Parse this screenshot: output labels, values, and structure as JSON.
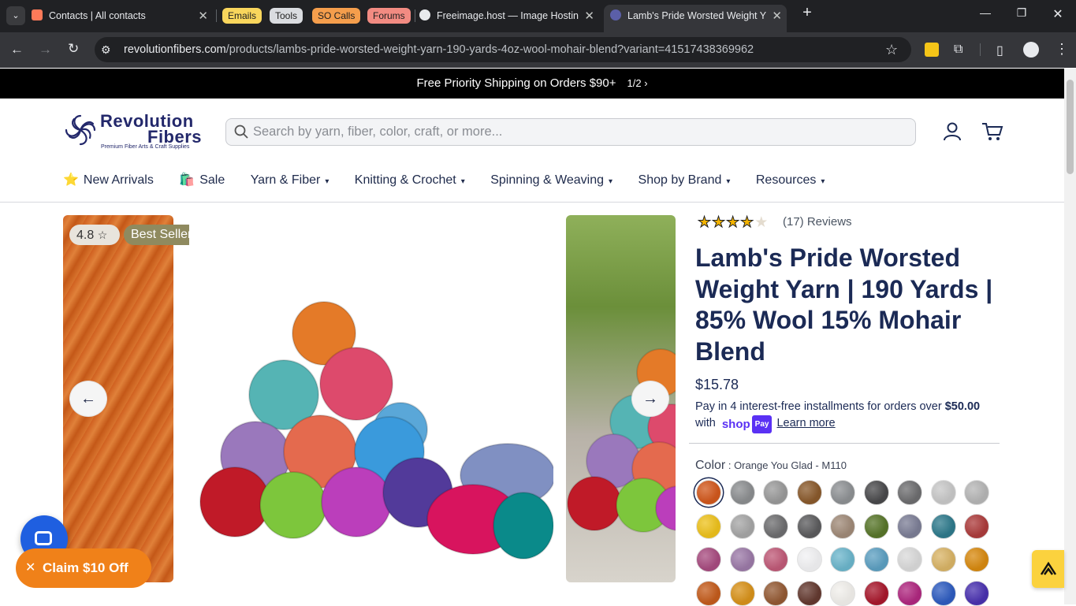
{
  "browser": {
    "tabs": [
      {
        "title": "Contacts | All contacts",
        "active": false
      },
      {
        "title": "Freeimage.host — Image Hostin",
        "active": false
      },
      {
        "title": "Lamb's Pride Worsted Weight Y",
        "active": true
      }
    ],
    "bookmark_chips": [
      {
        "label": "Emails",
        "color": "#f9d65c"
      },
      {
        "label": "Tools",
        "color": "#dadce0"
      },
      {
        "label": "SO Calls",
        "color": "#f59e4c"
      },
      {
        "label": "Forums",
        "color": "#f28b82"
      }
    ],
    "url_domain": "revolutionfibers.com",
    "url_path": "/products/lambs-pride-worsted-weight-yarn-190-yards-4oz-wool-mohair-blend?variant=41517438369962"
  },
  "promo": {
    "text": "Free Priority Shipping on Orders $90+",
    "page": "1/2"
  },
  "logo": {
    "line1": "Revolution",
    "line2": "Fibers",
    "tagline": "Premium Fiber Arts & Craft Supplies"
  },
  "search": {
    "placeholder": "Search by yarn, fiber, color, craft, or more..."
  },
  "nav": [
    {
      "label": "New Arrivals",
      "emoji": "⭐",
      "dropdown": false
    },
    {
      "label": "Sale",
      "emoji": "🛍️",
      "dropdown": false
    },
    {
      "label": "Yarn & Fiber",
      "dropdown": true
    },
    {
      "label": "Knitting & Crochet",
      "dropdown": true
    },
    {
      "label": "Spinning & Weaving",
      "dropdown": true
    },
    {
      "label": "Shop by Brand",
      "dropdown": true
    },
    {
      "label": "Resources",
      "dropdown": true
    }
  ],
  "gallery": {
    "rating": "4.8",
    "badge": "Best Seller"
  },
  "product": {
    "reviews": "(17) Reviews",
    "stars_filled": 4,
    "title": "Lamb's Pride Worsted Weight Yarn | 190 Yards | 85% Wool 15% Mohair Blend",
    "price": "$15.78",
    "installments_prefix": "Pay in 4 interest-free installments for orders over ",
    "installments_amount": "$50.00",
    "with": "with",
    "shop": "shop",
    "pay": "Pay",
    "learn_more": "Learn more",
    "color_label": "Color",
    "color_value": " : Orange You Glad - M110",
    "swatches": [
      [
        "#d2581c",
        "#8c8e90",
        "#9a9a9a",
        "#8a5a2c",
        "#8e9194",
        "#4a4a4c",
        "#6e6e70",
        "#c8c8c8",
        "#b6b6b6"
      ],
      [
        "#eec21c",
        "#a6a6a6",
        "#6e6e70",
        "#5c5c5e",
        "#a08a78",
        "#58762a",
        "#7c7e96",
        "#2e7a8c",
        "#ad3c3c"
      ],
      [
        "#a84c80",
        "#9c7aa8",
        "#c05a78",
        "#f2f2f4",
        "#6cb6cc",
        "#5da0c2",
        "#dadada",
        "#d9b466",
        "#d88a10"
      ],
      [
        "#c45c1c",
        "#d8921a",
        "#945a34",
        "#643a30",
        "#f2f0ec",
        "#a8182c",
        "#b02880",
        "#2e5cc0",
        "#4a32b0"
      ]
    ]
  },
  "floating": {
    "claim": "Claim $10 Off"
  }
}
